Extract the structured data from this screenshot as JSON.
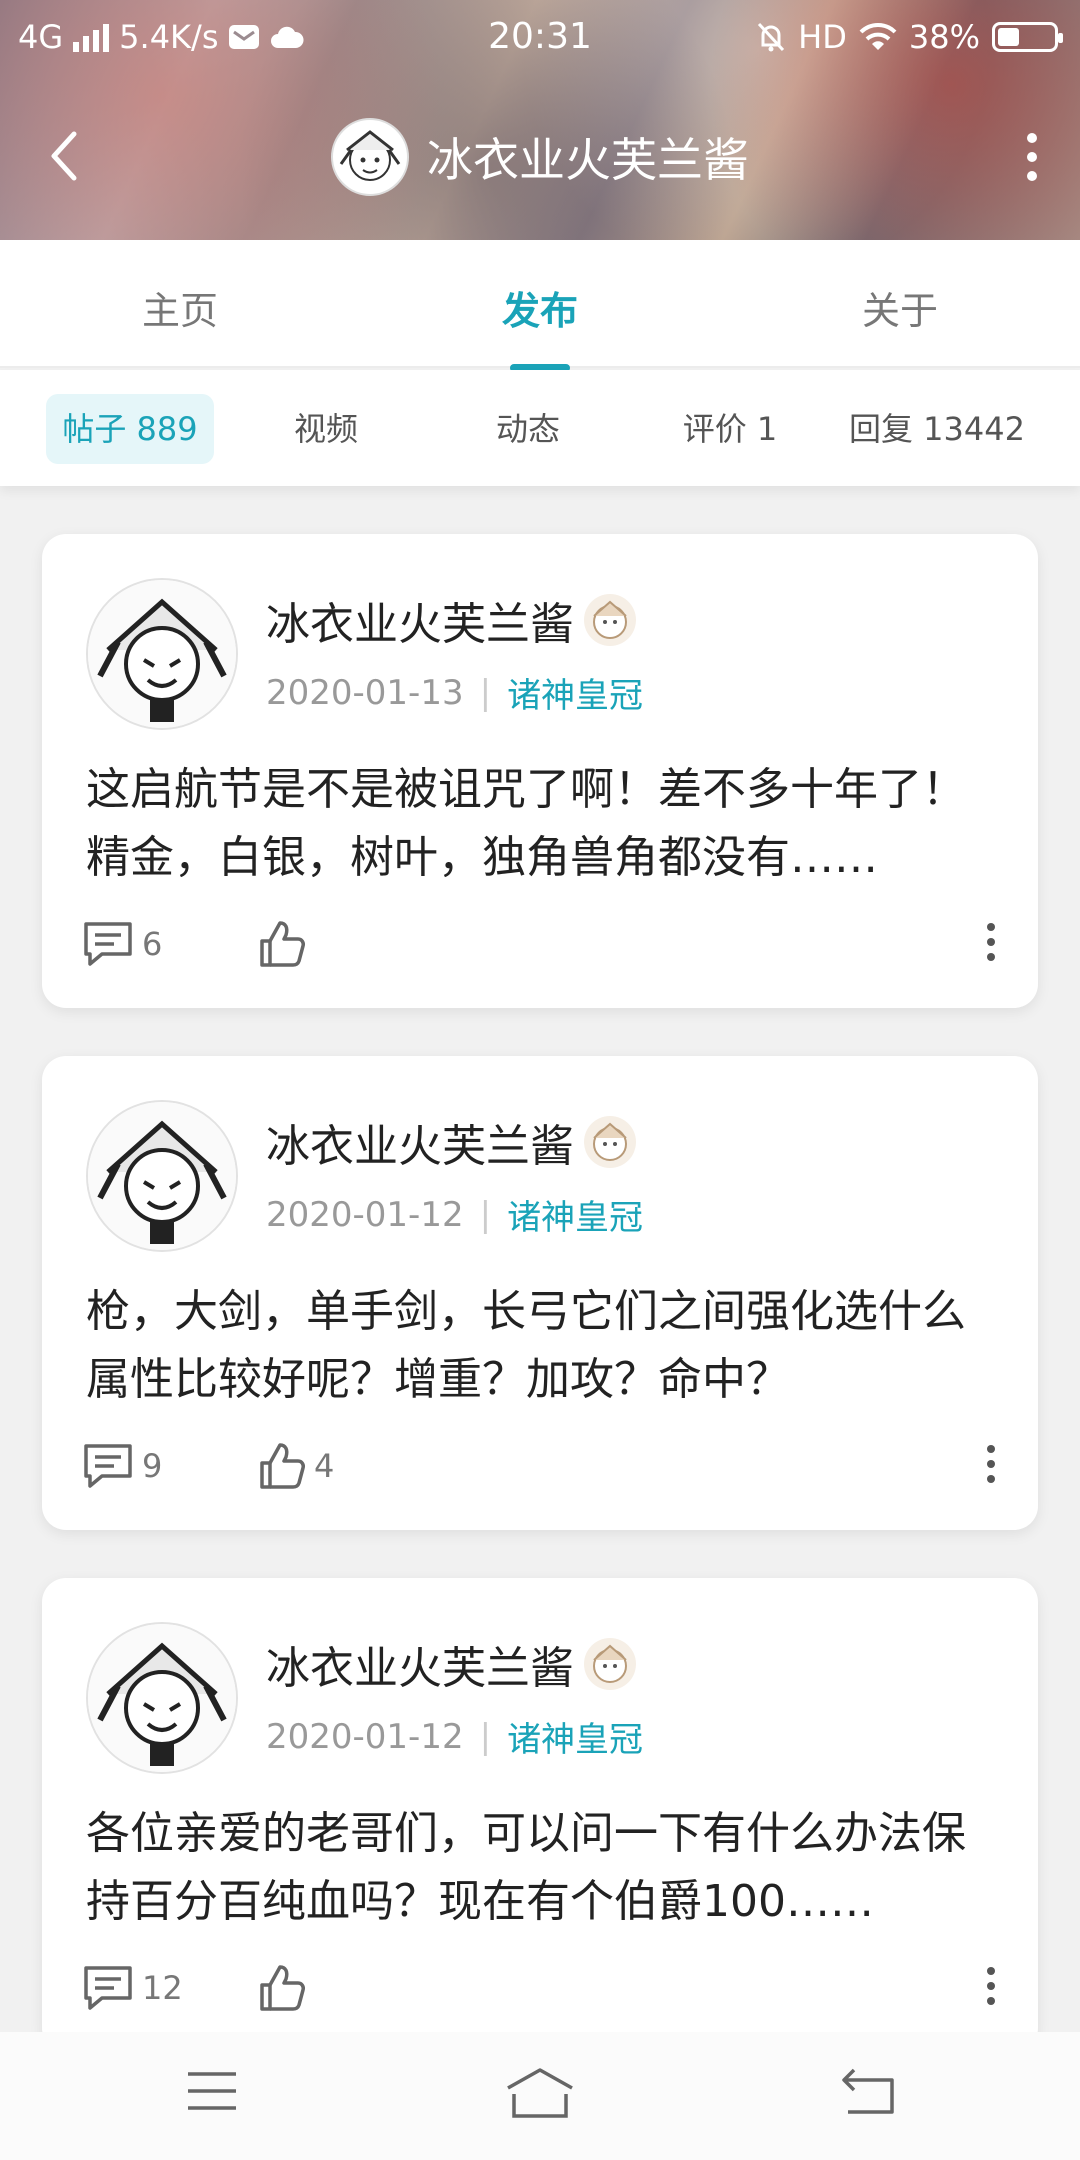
{
  "status_bar": {
    "network": "4G",
    "speed": "5.4K/s",
    "time": "20:31",
    "hd": "HD",
    "battery": "38%",
    "battery_level": 0.38
  },
  "header": {
    "title": "冰衣业火芙兰酱"
  },
  "main_tabs": [
    {
      "label": "主页",
      "active": false
    },
    {
      "label": "发布",
      "active": true
    },
    {
      "label": "关于",
      "active": false
    }
  ],
  "sub_tabs": [
    {
      "label": "帖子 889",
      "active": true
    },
    {
      "label": "视频",
      "active": false
    },
    {
      "label": "动态",
      "active": false
    },
    {
      "label": "评价 1",
      "active": false
    },
    {
      "label": "回复 13442",
      "active": false
    }
  ],
  "posts": [
    {
      "author": "冰衣业火芙兰酱",
      "date": "2020-01-13",
      "separator": "|",
      "tag": "诸神皇冠",
      "body": "这启航节是不是被诅咒了啊！差不多十年了！精金，白银，树叶，独角兽角都没有……",
      "comments": "6",
      "likes": ""
    },
    {
      "author": "冰衣业火芙兰酱",
      "date": "2020-01-12",
      "separator": "|",
      "tag": "诸神皇冠",
      "body": "枪，大剑，单手剑，长弓它们之间强化选什么属性比较好呢？增重？加攻？命中？",
      "comments": "9",
      "likes": "4"
    },
    {
      "author": "冰衣业火芙兰酱",
      "date": "2020-01-12",
      "separator": "|",
      "tag": "诸神皇冠",
      "body": "各位亲爱的老哥们，可以问一下有什么办法保持百分百纯血吗？现在有个伯爵100……",
      "comments": "12",
      "likes": ""
    }
  ],
  "colors": {
    "accent": "#1aa3b8",
    "card": "#ffffff",
    "background": "#f1f1f1"
  }
}
